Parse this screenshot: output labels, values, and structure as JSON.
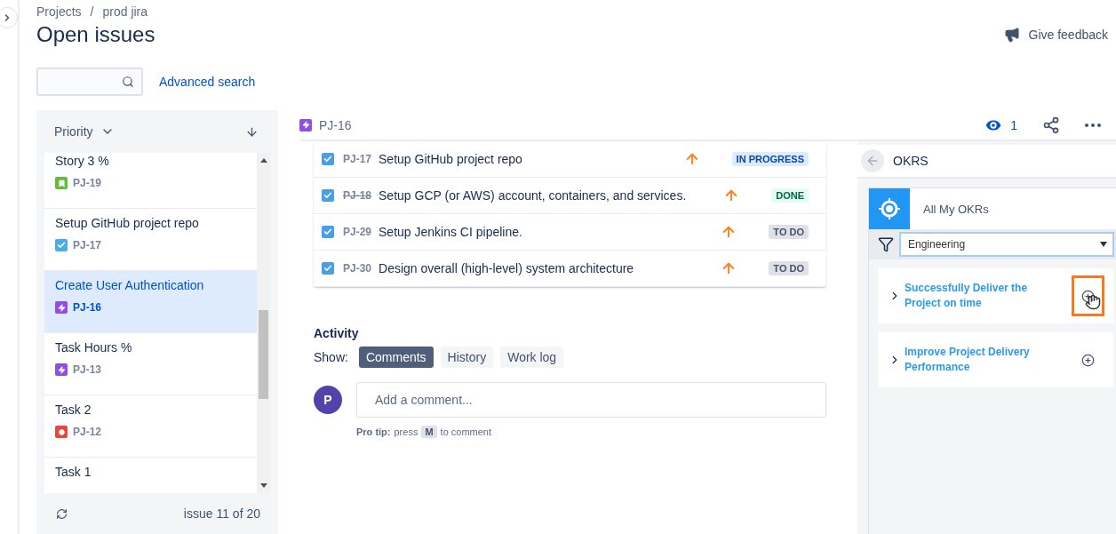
{
  "breadcrumbs": [
    "Projects",
    "prod jira"
  ],
  "breadcrumb_separator": "/",
  "title": "Open issues",
  "feedback": "Give feedback",
  "advanced_search": "Advanced search",
  "list": {
    "sort": "Priority",
    "footer": "issue 11 of 20",
    "items": [
      {
        "title": "Story 3 %",
        "key": "PJ-19",
        "kind": "story",
        "selected": false
      },
      {
        "title": "Setup GitHub project repo",
        "key": "PJ-17",
        "kind": "task",
        "selected": false
      },
      {
        "title": "Create User Authentication",
        "key": "PJ-16",
        "kind": "epic",
        "selected": true
      },
      {
        "title": "Task Hours %",
        "key": "PJ-13",
        "kind": "epic",
        "selected": false
      },
      {
        "title": "Task 2",
        "key": "PJ-12",
        "kind": "bug",
        "selected": false
      },
      {
        "title": "Task 1",
        "selected": false
      }
    ]
  },
  "issue": {
    "key": "PJ-16",
    "kind": "epic",
    "watchers": "1"
  },
  "subtasks": [
    {
      "key": "PJ-17",
      "title": "Setup GitHub project repo",
      "checked": true,
      "resolved": false,
      "status": "IN PROGRESS",
      "kind": "progress"
    },
    {
      "key": "PJ-18",
      "title": "Setup GCP (or AWS) account, containers, and services.",
      "checked": true,
      "resolved": true,
      "status": "DONE",
      "kind": "done"
    },
    {
      "key": "PJ-29",
      "title": "Setup Jenkins CI pipeline.",
      "checked": true,
      "resolved": false,
      "status": "TO DO",
      "kind": "todo"
    },
    {
      "key": "PJ-30",
      "title": "Design overall (high-level) system architecture",
      "checked": true,
      "resolved": false,
      "status": "TO DO",
      "kind": "todo"
    }
  ],
  "activity": {
    "title": "Activity",
    "show_label": "Show:",
    "tabs": [
      {
        "label": "Comments",
        "selected": true
      },
      {
        "label": "History",
        "selected": false
      },
      {
        "label": "Work log",
        "selected": false
      }
    ],
    "avatar": "P",
    "comment_placeholder": "Add a comment...",
    "tip_label": "Pro tip:",
    "tip_pre": "press",
    "tip_key": "M",
    "tip_post": "to comment"
  },
  "okrs": {
    "title": "OKRS",
    "heading": "All My OKRs",
    "filter": "Engineering",
    "items": [
      {
        "title": "Successfully Deliver the Project on time",
        "highlighted": true
      },
      {
        "title": "Improve Project Delivery Performance",
        "highlighted": false
      }
    ]
  }
}
